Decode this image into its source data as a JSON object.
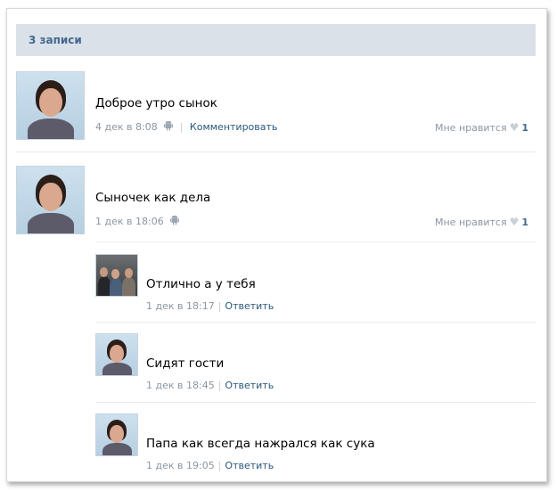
{
  "header": {
    "title": "3 записи"
  },
  "posts": [
    {
      "text": "Доброе утро сынок",
      "date": "4 дек в 8:08",
      "action": "Комментировать",
      "like_label": "Мне нравится",
      "like_count": "1"
    },
    {
      "text": "Сыночек как дела",
      "date": "1 дек в 18:06",
      "like_label": "Мне нравится",
      "like_count": "1"
    }
  ],
  "replies": [
    {
      "text": "Отлично а у тебя",
      "date": "1 дек в 18:17",
      "action": "Ответить"
    },
    {
      "text": "Сидят гости",
      "date": "1 дек в 18:45",
      "action": "Ответить"
    },
    {
      "text": "Папа как всегда нажрался как сука",
      "date": "1 дек в 19:05",
      "action": "Ответить"
    }
  ]
}
